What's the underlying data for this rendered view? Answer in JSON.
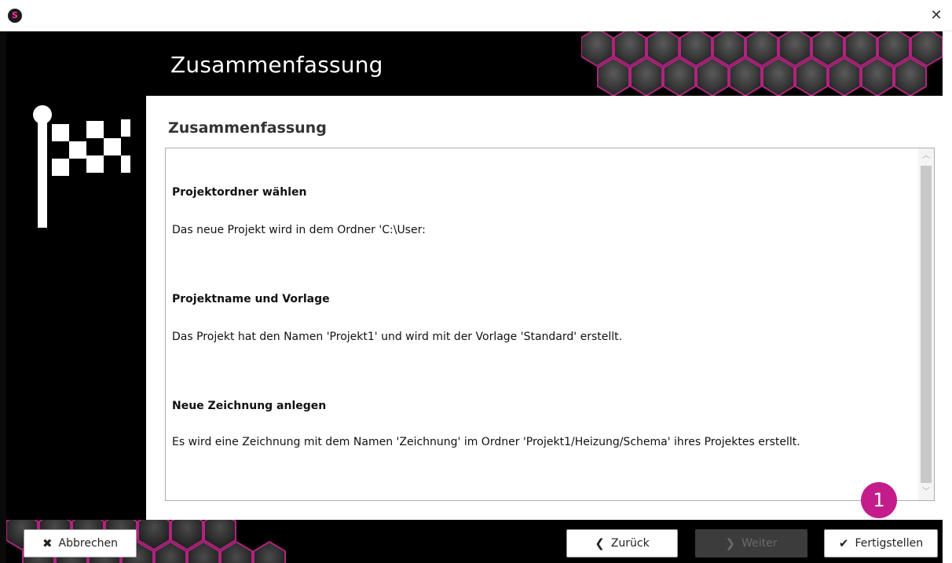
{
  "window": {
    "app_icon": "S",
    "close_icon": "close-icon"
  },
  "header": {
    "title": "Zusammenfassung"
  },
  "content": {
    "heading": "Zusammenfassung",
    "sections": [
      {
        "title": "Projektordner wählen",
        "text": "Das neue Projekt wird in dem Ordner 'C:\\User:"
      },
      {
        "title": "Projektname und Vorlage",
        "text": "Das Projekt hat den Namen 'Projekt1' und wird mit der Vorlage 'Standard' erstellt."
      },
      {
        "title": "Neue Zeichnung anlegen",
        "text": "Es wird eine Zeichnung mit dem Namen 'Zeichnung' im Ordner 'Projekt1/Heizung/Schema' ihres Projektes erstellt."
      }
    ]
  },
  "footer": {
    "cancel_label": "Abbrechen",
    "back_label": "Zurück",
    "next_label": "Weiter",
    "finish_label": "Fertigstellen"
  },
  "annotation": {
    "badge_number": "1"
  },
  "colors": {
    "accent": "#c41d8b",
    "dark": "#000000"
  }
}
